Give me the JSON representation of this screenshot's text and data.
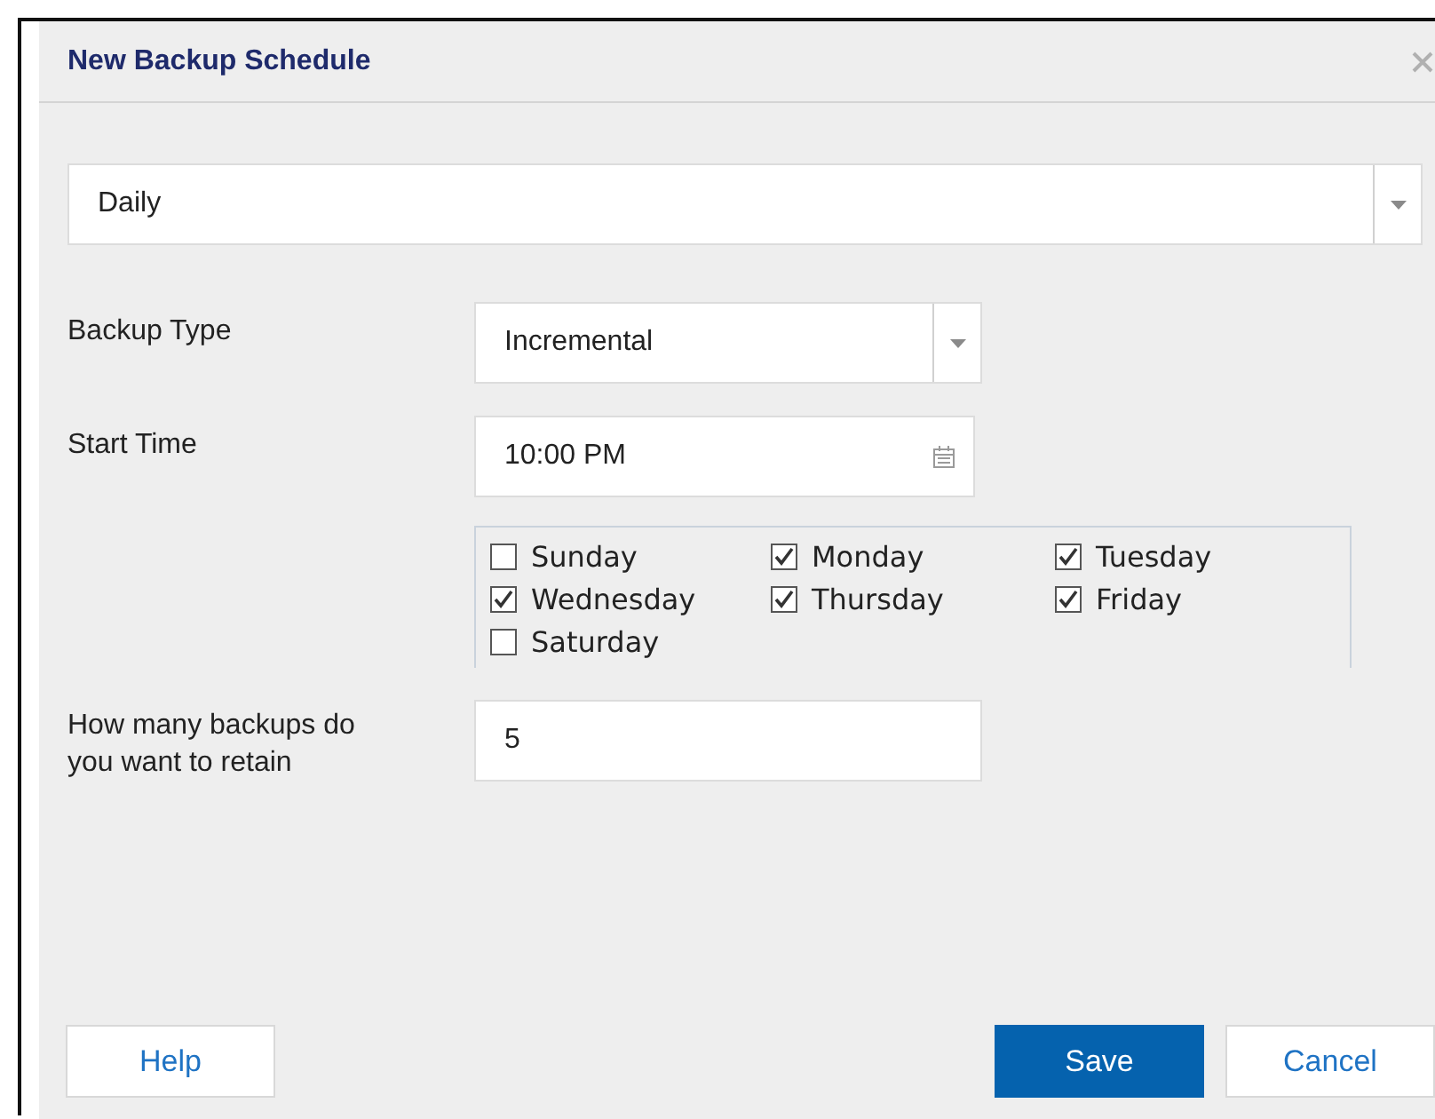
{
  "dialog": {
    "title": "New Backup Schedule"
  },
  "frequency": {
    "value": "Daily"
  },
  "fields": [
    {
      "kind": "select",
      "label": "Backup Type",
      "value": "Incremental"
    },
    {
      "kind": "time",
      "label": "Start Time",
      "value": "10:00 PM"
    }
  ],
  "days": [
    {
      "label": "Sunday",
      "checked": false
    },
    {
      "label": "Monday",
      "checked": true
    },
    {
      "label": "Tuesday",
      "checked": true
    },
    {
      "label": "Wednesday",
      "checked": true
    },
    {
      "label": "Thursday",
      "checked": true
    },
    {
      "label": "Friday",
      "checked": true
    },
    {
      "label": "Saturday",
      "checked": false
    }
  ],
  "retain": {
    "label": "How many backups do you want to retain",
    "value": "5"
  },
  "footer_left": [
    {
      "label": "Help"
    }
  ],
  "footer_right": [
    {
      "label": "Save",
      "kind": "primary"
    },
    {
      "label": "Cancel",
      "kind": "secondary"
    }
  ]
}
